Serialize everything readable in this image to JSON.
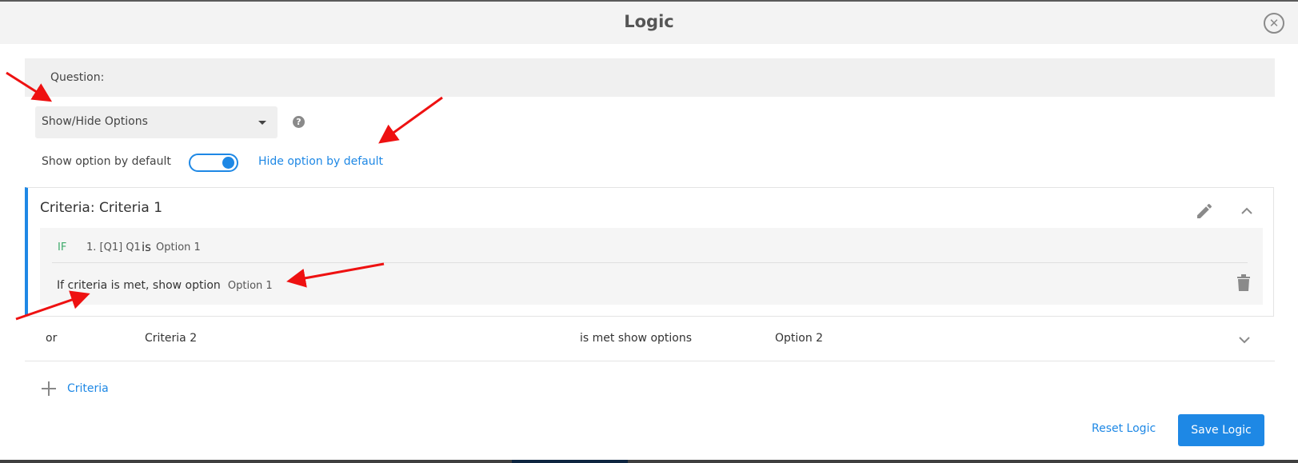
{
  "modal": {
    "title": "Logic",
    "close_icon": "close-circle-icon"
  },
  "question": {
    "label": "Question:"
  },
  "logic_type": {
    "selected": "Show/Hide Options",
    "help_icon": "question-circle-icon",
    "help_glyph": "?"
  },
  "default_toggle": {
    "left_label": "Show option by default",
    "right_label": "Hide option by default",
    "state": "on"
  },
  "criteria_1": {
    "title": "Criteria: Criteria 1",
    "if_keyword": "IF",
    "question_ref": "1. [Q1] Q1",
    "operator": "is",
    "value": "Option 1",
    "action_label": "If criteria is met, show option",
    "action_value": "Option 1"
  },
  "criteria_2": {
    "connector": "or",
    "name": "Criteria 2",
    "met_label": "is met show options",
    "option": "Option 2"
  },
  "add_criteria": {
    "label": "Criteria"
  },
  "footer": {
    "reset_label": "Reset Logic",
    "save_label": "Save Logic"
  },
  "colors": {
    "accent": "#1e88e5",
    "if_green": "#3daa6a",
    "annotation_red": "#ee1111"
  }
}
